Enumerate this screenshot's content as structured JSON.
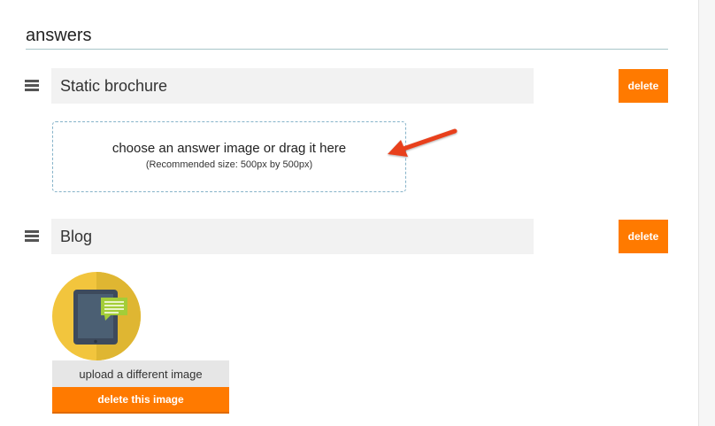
{
  "section": {
    "title": "answers"
  },
  "answers": [
    {
      "text": "Static brochure",
      "delete_label": "delete",
      "dropzone": {
        "main_text": "choose an answer image or drag it here",
        "sub_text": "(Recommended size: 500px by 500px)"
      }
    },
    {
      "text": "Blog",
      "delete_label": "delete",
      "image": {
        "icon": "tablet-chat-icon",
        "upload_label": "upload a different image",
        "delete_label": "delete this image"
      }
    }
  ],
  "colors": {
    "accent": "#ff7a00",
    "field_bg": "#f2f2f2",
    "dropzone_border": "#86b3c9",
    "annotation_arrow": "#e8401c",
    "image_circle": "#f2c53d",
    "tablet": "#3d4a5c",
    "chat_bubble": "#a3cd39"
  }
}
